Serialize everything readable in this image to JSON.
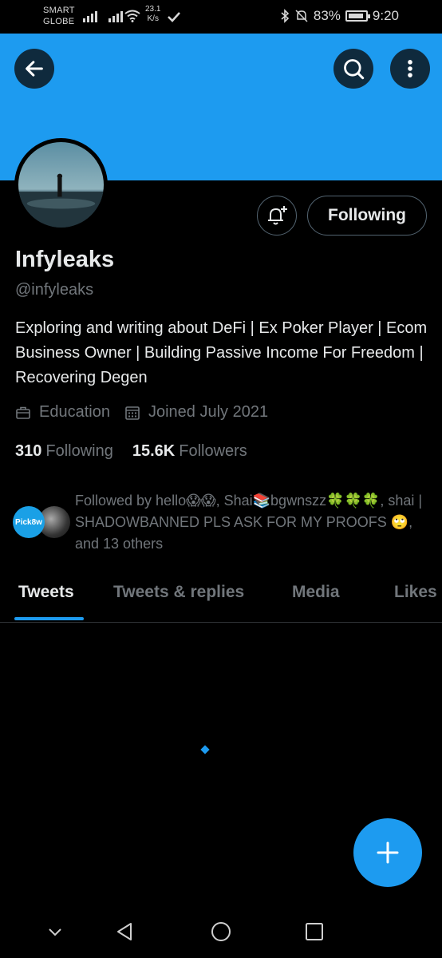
{
  "status_bar": {
    "carrier_line1": "SMART",
    "carrier_line2": "GLOBE",
    "net_speed_value": "23.1",
    "net_speed_unit": "K/s",
    "battery": "83%",
    "time": "9:20"
  },
  "header": {
    "back_icon": "arrow-left-icon",
    "search_icon": "search-icon",
    "more_icon": "more-vertical-icon",
    "banner_color": "#1d9bf0"
  },
  "profile": {
    "name": "Infyleaks",
    "handle": "@infyleaks",
    "bio": "Exploring and writing about DeFi | Ex Poker Player | Ecom Business Owner | Building Passive Income For Freedom | Recovering Degen",
    "category": "Education",
    "joined": "Joined July 2021",
    "following_count": "310",
    "following_label": "Following",
    "followers_count": "15.6K",
    "followers_label": "Followers",
    "follow_button": "Following"
  },
  "followed_by": {
    "avatar1_text": "Pick8w",
    "text": "Followed by hello😱😱, Shai📚bgwnszz🍀🍀🍀, shai | SHADOWBANNED PLS ASK FOR MY PROOFS 🙄, and 13 others"
  },
  "tabs": [
    {
      "label": "Tweets",
      "active": true
    },
    {
      "label": "Tweets & replies",
      "active": false
    },
    {
      "label": "Media",
      "active": false
    },
    {
      "label": "Likes",
      "active": false
    }
  ],
  "accent_color": "#1d9bf0"
}
